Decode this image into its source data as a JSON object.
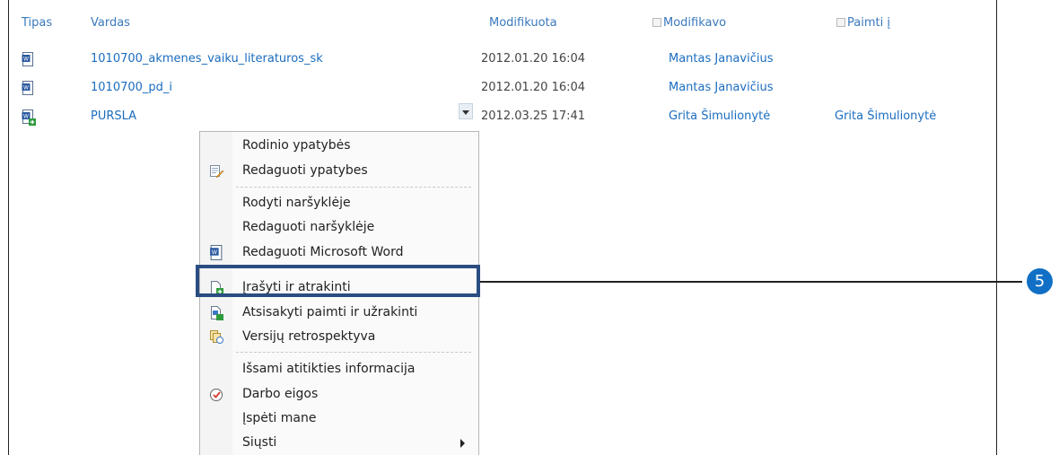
{
  "headers": {
    "type": "Tipas",
    "name": "Vardas",
    "modified": "Modifikuota",
    "modified_by": "Modifikavo",
    "checked_out": "Paimti į"
  },
  "rows": [
    {
      "name": "1010700_akmenes_vaiku_literaturos_sk",
      "date": "2012.01.20 16:04",
      "modified_by": "Mantas Janavičius",
      "checked_out_to": "",
      "icon": "word-doc-icon"
    },
    {
      "name": "1010700_pd_i",
      "date": "2012.01.20 16:04",
      "modified_by": "Mantas Janavičius",
      "checked_out_to": "",
      "icon": "word-doc-icon"
    },
    {
      "name": "PURSLA",
      "date": "2012.03.25 17:41",
      "modified_by": "Grita Šimulionytė",
      "checked_out_to": "Grita Šimulionytė",
      "icon": "word-doc-checked-out-icon"
    }
  ],
  "menu": {
    "items": [
      {
        "label": "Rodinio ypatybės",
        "icon": ""
      },
      {
        "label": "Redaguoti ypatybes",
        "icon": "edit-properties-icon"
      },
      {
        "label": "Rodyti naršyklėje",
        "icon": ""
      },
      {
        "label": "Redaguoti naršyklėje",
        "icon": ""
      },
      {
        "label": "Redaguoti Microsoft Word",
        "icon": "word-icon"
      },
      {
        "label": "Įrašyti ir atrakinti",
        "icon": "check-in-icon"
      },
      {
        "label": "Atsisakyti paimti ir užrakinti",
        "icon": "discard-checkout-icon"
      },
      {
        "label": "Versijų retrospektyva",
        "icon": "version-history-icon"
      },
      {
        "label": "Išsami atitikties informacija",
        "icon": ""
      },
      {
        "label": "Darbo eigos",
        "icon": "workflow-icon"
      },
      {
        "label": "Įspėti mane",
        "icon": ""
      },
      {
        "label": "Siųsti",
        "icon": ""
      }
    ]
  },
  "callout": {
    "number": "5"
  },
  "colors": {
    "link": "#1b6dbf",
    "highlight_border": "#2a4d82",
    "badge": "#1170c5"
  }
}
